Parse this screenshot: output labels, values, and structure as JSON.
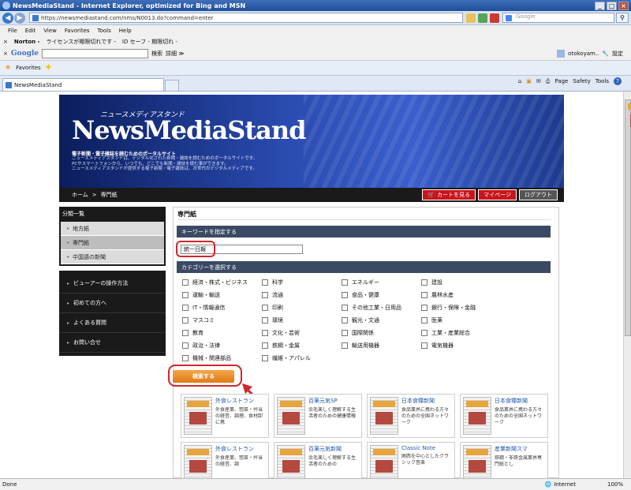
{
  "window": {
    "title": "NewsMediaStand - Internet Explorer, optimized for Bing and MSN"
  },
  "address": {
    "url": "https://newsmediastand.com/nms/N0013.do?command=enter",
    "search_placeholder": "Google"
  },
  "menu": [
    "File",
    "Edit",
    "View",
    "Favorites",
    "Tools",
    "Help"
  ],
  "norton": {
    "brand": "Norton -",
    "license": "ライセンスが期限切れです -",
    "safe": "ID セーフ - 期限切れ -"
  },
  "googlebar": {
    "brand": "Google",
    "search": "検索",
    "more": "詳細 ≫",
    "user": "otokoyam..",
    "settings": "設定"
  },
  "favorites": {
    "label": "Favorites"
  },
  "tabs": {
    "active": "NewsMediaStand",
    "page": "Page",
    "safety": "Safety",
    "tools": "Tools",
    "help": "?"
  },
  "status": {
    "left": "Done",
    "zone": "Internet",
    "zoom": "100%"
  },
  "banner": {
    "kana": "ニュースメディアスタンド",
    "logo": "NewsMediaStand",
    "tagline": "電子新聞・電子雑誌を読むためのポータルサイト",
    "desc1": "ニュースメディアスタンドは、デジタル化された新聞・雑誌を読むためのポータルサイトです。",
    "desc2": "PCやスマートフォンから、いつでも、どこでも新聞・雑誌を読む事ができます。",
    "desc3": "ニュースメディアスタンドが提供する電子新聞・電子雑誌は、次世代のデジタルメディアです。"
  },
  "breadcrumb": {
    "home": "ホーム",
    "sep": ">",
    "current": "専門紙"
  },
  "topbuttons": {
    "cart": "カートを見る",
    "mypage": "マイページ",
    "logout": "ログアウト"
  },
  "sidebar": {
    "heading": "分類一覧",
    "items": [
      "地方紙",
      "専門紙",
      "中国語の新聞"
    ],
    "help": [
      "ビューアーの操作方法",
      "初めての方へ",
      "よくある質問",
      "お問い合せ"
    ]
  },
  "main": {
    "title": "専門紙",
    "keyword_header": "キーワードを指定する",
    "keyword_value": "統一日報",
    "category_header": "カテゴリーを選択する",
    "search_button": "検索する",
    "categories": [
      [
        "経済・株式・ビジネス",
        "科学",
        "エネルギー",
        "建設"
      ],
      [
        "運輸・輸送",
        "流通",
        "食品・健康",
        "農林水産"
      ],
      [
        "IT・情報通信",
        "印刷",
        "その他工業・日用品",
        "銀行・保険・金融"
      ],
      [
        "マスコミ",
        "環境",
        "観光・文通",
        "医薬"
      ],
      [
        "教育",
        "文化・芸術",
        "国際関係",
        "工業・産業総合"
      ],
      [
        "政治・法律",
        "鉄鋼・金属",
        "輸送用機器",
        "電気機器"
      ],
      [
        "機械・関連部品",
        "繊維・アパレル"
      ]
    ],
    "papers": [
      [
        {
          "title": "外食レストラン",
          "desc": "外食産業、惣菜・弁当の経営、調理、食材卸に携"
        },
        {
          "title": "百薬元気SP",
          "desc": "余毛楽しく理解する生活者のための健康情報"
        },
        {
          "title": "日本食糧新聞",
          "desc": "食品業界に携わる方々のための全国ネットワーク"
        },
        {
          "title": "日本食糧新聞",
          "desc": "食品業界に携わる方々のための全国ネットワーク"
        }
      ],
      [
        {
          "title": "外食レストラン",
          "desc": "外食産業、惣菜・弁当の経営、調"
        },
        {
          "title": "百薬元気新聞",
          "desc": "余毛楽しく理解する生活者のための"
        },
        {
          "title": "Classic Note",
          "desc": "関西を中心としたクラシック音楽"
        },
        {
          "title": "産業新聞スマ",
          "desc": "鉄鋼・非鉄金属業界専門紙とし"
        }
      ]
    ]
  }
}
